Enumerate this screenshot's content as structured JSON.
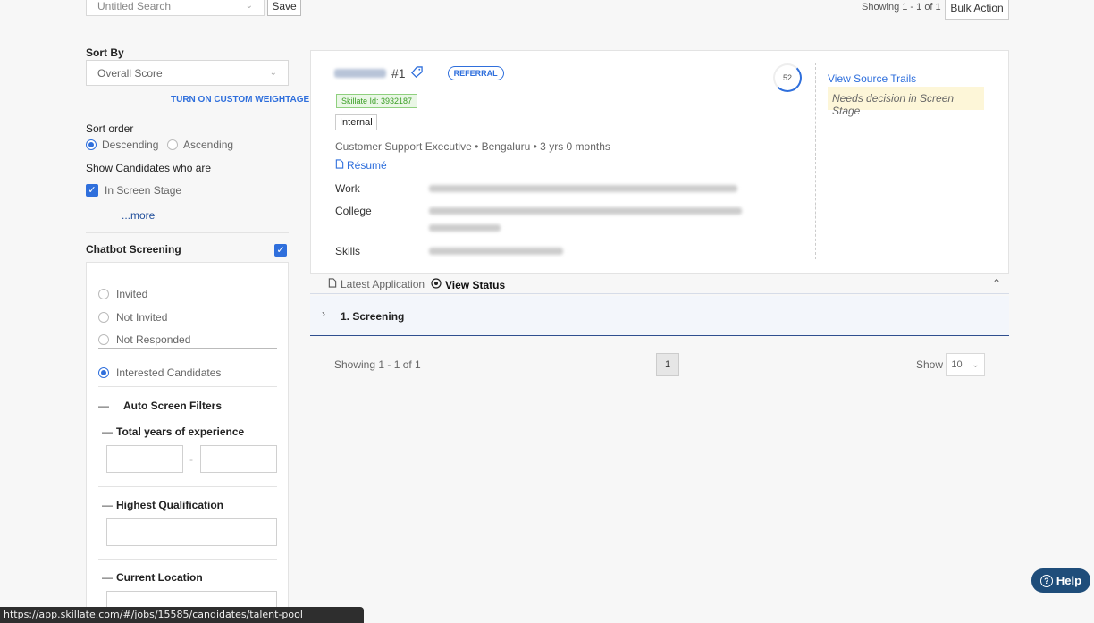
{
  "topbar": {
    "search_value": "Untitled Search",
    "save_label": "Save",
    "showing": "Showing 1 - 1 of 1",
    "bulk_action": "Bulk Action"
  },
  "sidebar": {
    "sort_by_label": "Sort By",
    "sort_by_value": "Overall Score",
    "custom_weightage": "TURN ON CUSTOM WEIGHTAGE",
    "sort_order_label": "Sort order",
    "descending": "Descending",
    "ascending": "Ascending",
    "show_candidates_label": "Show Candidates who are",
    "in_screen_stage": "In Screen Stage",
    "more": "...more",
    "chatbot_label": "Chatbot Screening",
    "invited": "Invited",
    "not_invited": "Not Invited",
    "not_responded": "Not Responded",
    "interested": "Interested Candidates",
    "auto_filters": "Auto Screen Filters",
    "total_experience": "Total years of experience",
    "range_sep": "-",
    "highest_qualification": "Highest Qualification",
    "current_location": "Current Location"
  },
  "candidate": {
    "rank": "#1",
    "referral": "REFERRAL",
    "skillate_id": "Skillate Id: 3932187",
    "internal": "Internal",
    "summary": "Customer Support Executive • Bengaluru • 3 yrs 0 months",
    "resume": "Résumé",
    "work_label": "Work",
    "college_label": "College",
    "skills_label": "Skills",
    "score": "52",
    "view_source_trails": "View Source Trails",
    "decision": "Needs decision in Screen Stage"
  },
  "tabs": {
    "latest_application": "Latest Application",
    "view_status": "View Status",
    "screening": "1. Screening"
  },
  "pagination": {
    "showing": "Showing 1 - 1 of 1",
    "page": "1",
    "show_label": "Show",
    "show_value": "10"
  },
  "help": "Help",
  "status_url": "https://app.skillate.com/#/jobs/15585/candidates/talent-pool"
}
